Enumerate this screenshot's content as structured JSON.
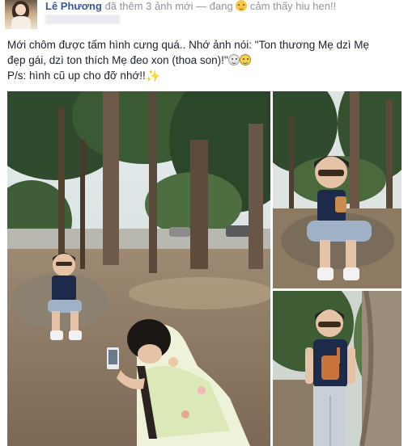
{
  "header": {
    "author": "Lê Phương",
    "action": "đã thêm 3 ảnh mới — đang",
    "feeling": "cảm thấy hiu hen!!",
    "feeling_icon": "smiley-face-icon"
  },
  "post": {
    "line1": "Mới chôm được tấm hình cưng quá.. Nhớ ảnh nói: \"Ton thương Mẹ dzì Mẹ",
    "line2": "đẹp gái, dzì ton thích Mẹ đeo xon (thoa son)!\"",
    "line3": "P/s: hình cũ up cho đỡ nhớ!!",
    "emoji_icons": [
      "smiley-icon",
      "grinning-icon",
      "sparkles-icon"
    ]
  },
  "photos": [
    {
      "name": "photo-boy-sitting-mother-photographing"
    },
    {
      "name": "photo-boy-sitting-sunglasses"
    },
    {
      "name": "photo-boy-standing-guitar-shirt"
    }
  ],
  "colors": {
    "link": "#365899",
    "meta_text": "#90949c",
    "body_text": "#1d2129"
  }
}
